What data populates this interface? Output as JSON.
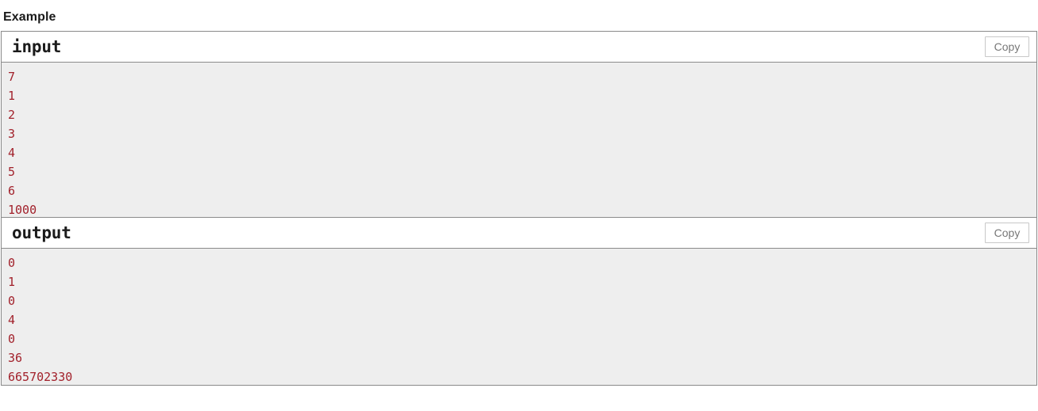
{
  "heading": "Example",
  "blocks": [
    {
      "title": "input",
      "copy_label": "Copy",
      "text": "7\n1\n2\n3\n4\n5\n6\n1000"
    },
    {
      "title": "output",
      "copy_label": "Copy",
      "text": "0\n1\n0\n4\n0\n36\n665702330"
    }
  ],
  "colors": {
    "code_text": "#a2212b",
    "content_bg": "#eeeeee",
    "border": "#8a8a8a",
    "button_border": "#c8c8c8",
    "button_text": "#777777",
    "heading_text": "#1a1a1a"
  }
}
